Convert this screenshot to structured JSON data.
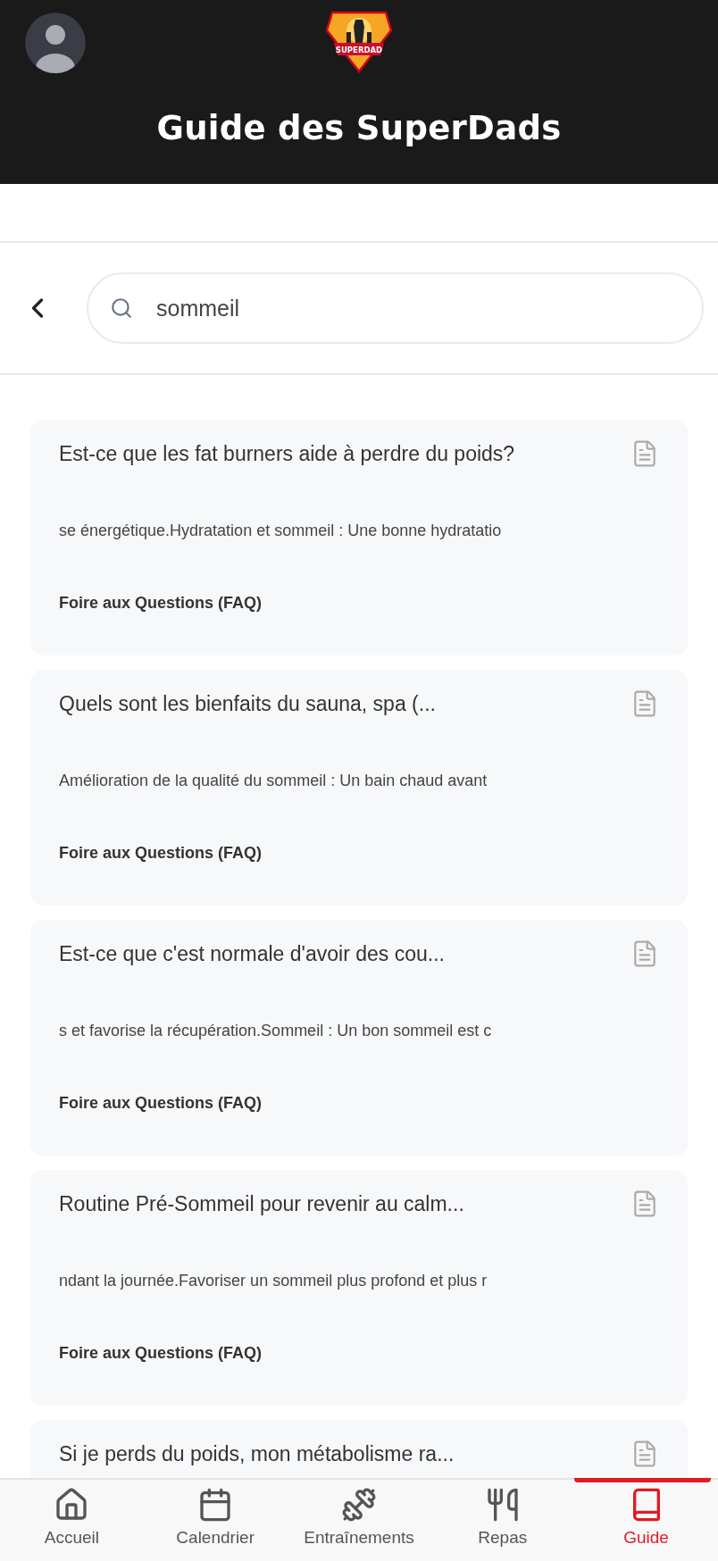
{
  "header": {
    "logo_text": "SUPERDAD",
    "title": "Guide des SuperDads"
  },
  "search": {
    "value": "sommeil"
  },
  "results": [
    {
      "title": "Est-ce que les fat burners aide à perdre du poids?",
      "snippet": "se énergétique.Hydratation et sommeil : Une bonne hydratatio",
      "category": "Foire aux Questions (FAQ)"
    },
    {
      "title": "Quels sont les bienfaits du sauna, spa (...",
      "snippet": "Amélioration de la qualité du sommeil : Un bain chaud avant",
      "category": "Foire aux Questions (FAQ)"
    },
    {
      "title": "Est-ce que c'est normale d'avoir des cou...",
      "snippet": "s et favorise la récupération.Sommeil : Un bon sommeil est c",
      "category": "Foire aux Questions (FAQ)"
    },
    {
      "title": "Routine Pré-Sommeil pour revenir au calm...",
      "snippet": "ndant la journée.Favoriser un sommeil plus profond et plus r",
      "category": "Foire aux Questions (FAQ)"
    },
    {
      "title": "Si je perds du poids, mon métabolisme ra..."
    }
  ],
  "nav": [
    {
      "kind": "home",
      "label": "Accueil",
      "selected": false
    },
    {
      "kind": "calendar",
      "label": "Calendrier",
      "selected": false
    },
    {
      "kind": "workout",
      "label": "Entraînements",
      "selected": false
    },
    {
      "kind": "meals",
      "label": "Repas",
      "selected": false
    },
    {
      "kind": "guide",
      "label": "Guide",
      "selected": true
    }
  ]
}
